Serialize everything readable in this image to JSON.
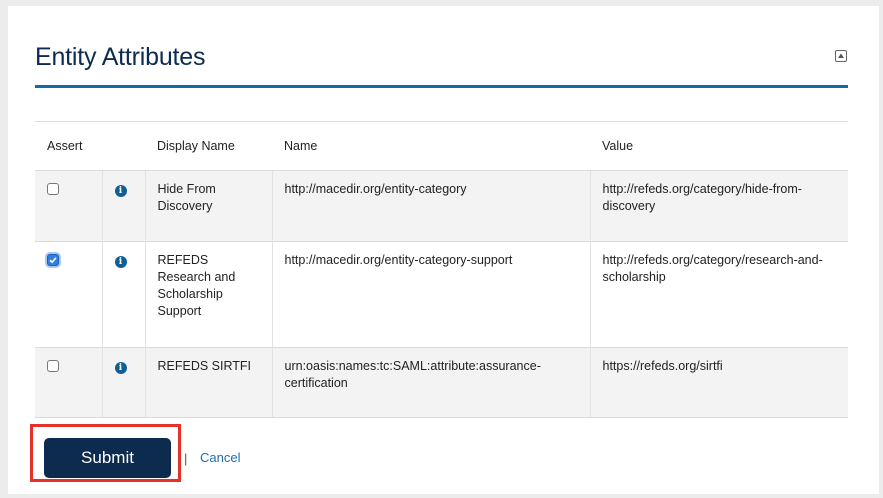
{
  "panel": {
    "title": "Entity Attributes",
    "collapse_icon": "collapse-up-icon"
  },
  "table": {
    "headers": {
      "assert": "Assert",
      "display_name": "Display Name",
      "name": "Name",
      "value": "Value"
    },
    "rows": [
      {
        "checked": false,
        "display_name": "Hide From Discovery",
        "name": "http://macedir.org/entity-category",
        "value": "http://refeds.org/category/hide-from-discovery"
      },
      {
        "checked": true,
        "display_name": "REFEDS Research and Scholarship Support",
        "name": "http://macedir.org/entity-category-support",
        "value": "http://refeds.org/category/research-and-scholarship"
      },
      {
        "checked": false,
        "display_name": "REFEDS SIRTFI",
        "name": "urn:oasis:names:tc:SAML:attribute:assurance-certification",
        "value": "https://refeds.org/sirtfi"
      }
    ]
  },
  "actions": {
    "submit_label": "Submit",
    "separator": "|",
    "cancel_label": "Cancel"
  },
  "colors": {
    "title": "#0d2b4f",
    "rule": "#0f6aa8",
    "submit_bg": "#0d2b4f",
    "highlight": "#e4322b",
    "link": "#1d6fb0"
  }
}
